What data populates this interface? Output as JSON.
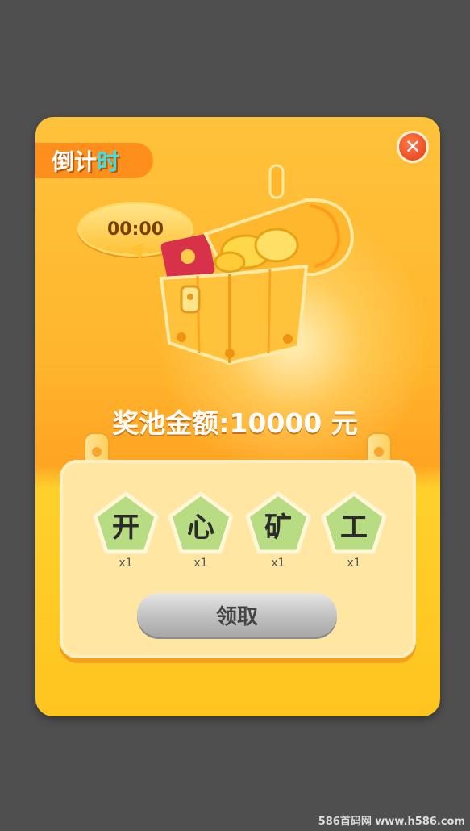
{
  "colors": {
    "background": "#4f4f4f",
    "card_orange": "#ffb62e",
    "tag_orange": "#ff8f1c",
    "pentagon_green": "#b8dc83"
  },
  "countdown_tag": {
    "prefix": "倒计",
    "highlight": "时"
  },
  "close_button": {
    "label": "✕",
    "icon": "close-icon"
  },
  "timer": {
    "value": "00:00"
  },
  "chest_icon": "treasure-chest-icon",
  "prize": {
    "label": "奖池金额:",
    "amount": "10000",
    "unit": "元"
  },
  "letters": [
    {
      "char": "开",
      "count": "x1"
    },
    {
      "char": "心",
      "count": "x1"
    },
    {
      "char": "矿",
      "count": "x1"
    },
    {
      "char": "工",
      "count": "x1"
    }
  ],
  "claim_button": {
    "label": "领取"
  },
  "watermark": "586首码网 www.h586.com"
}
